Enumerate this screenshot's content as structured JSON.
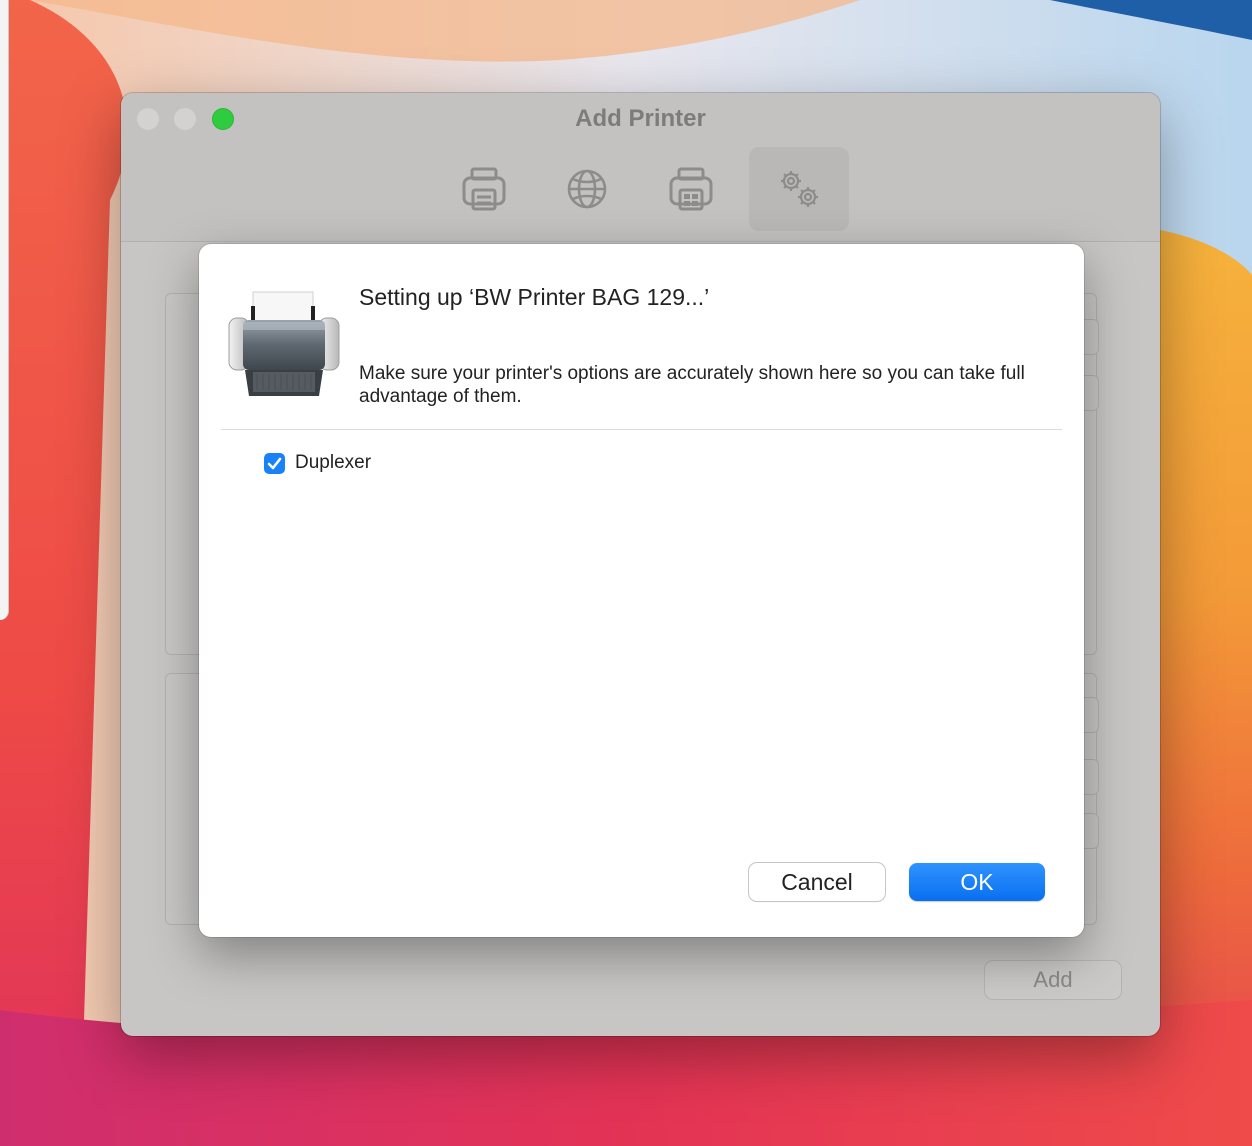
{
  "window": {
    "title": "Add Printer",
    "toolbar": [
      {
        "icon": "printer-icon"
      },
      {
        "icon": "globe-icon"
      },
      {
        "icon": "windows-printer-icon"
      },
      {
        "icon": "gears-icon",
        "selected": true
      }
    ],
    "add_label": "Add"
  },
  "sheet": {
    "title": "Setting up ‘BW Printer BAG 129...’",
    "description": "Make sure your printer's options are accurately shown here so you can take full advantage of them.",
    "options": [
      {
        "label": "Duplexer",
        "checked": true
      }
    ],
    "cancel_label": "Cancel",
    "ok_label": "OK"
  },
  "colors": {
    "accent": "#1a82f7",
    "zoom": "#2fcc3f"
  }
}
